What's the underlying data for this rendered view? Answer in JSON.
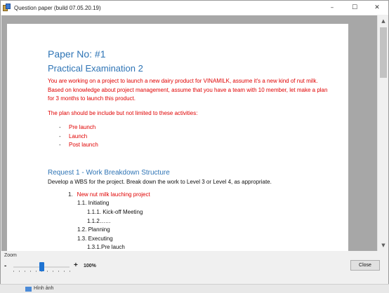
{
  "window": {
    "title": "Question paper (build 07.05.20.19)",
    "minimize_glyph": "–",
    "maximize_glyph": "☐",
    "close_glyph": "✕"
  },
  "document": {
    "paper_no": "Paper No: #1",
    "exam_title": "Practical Examination 2",
    "intro": "You are working on a project to launch a new dairy product for VINAMILK, assume it's a new kind of nut milk. Based on knowledge about project management, assume that you have a team with 10 member, let make a plan for 3 months to launch this product.",
    "plan_intro": "The plan should be include but not limited to these activities:",
    "activities": [
      "Pre launch",
      "Launch",
      "Post launch"
    ],
    "request_title": "Request 1 - Work Breakdown Structure",
    "request_desc": "Develop a WBS for the project. Break down the work to Level 3 or Level 4, as appropriate.",
    "wbs": {
      "item1_num": "1.",
      "item1_label": "New nut milk lauching project",
      "item_1_1": "1.1.  Initiating",
      "item_1_1_1": "1.1.1. Kick-off Meeting",
      "item_1_1_2": "1.1.2……",
      "item_1_2": "1.2.  Planning",
      "item_1_3": "1.3.  Executing",
      "item_1_3_1": "1.3.1.Pre lauch"
    }
  },
  "scrollbar": {
    "up_glyph": "▲",
    "down_glyph": "▼"
  },
  "zoom": {
    "label": "Zoom",
    "minus": "-",
    "plus": "+",
    "value": "100%",
    "level_fraction": 0.5
  },
  "buttons": {
    "close": "Close"
  },
  "taskbar": {
    "item_label": "Hình ảnh"
  },
  "colors": {
    "heading_blue": "#2e74b5",
    "body_red": "#e00000",
    "slider_accent": "#1e73d2"
  }
}
